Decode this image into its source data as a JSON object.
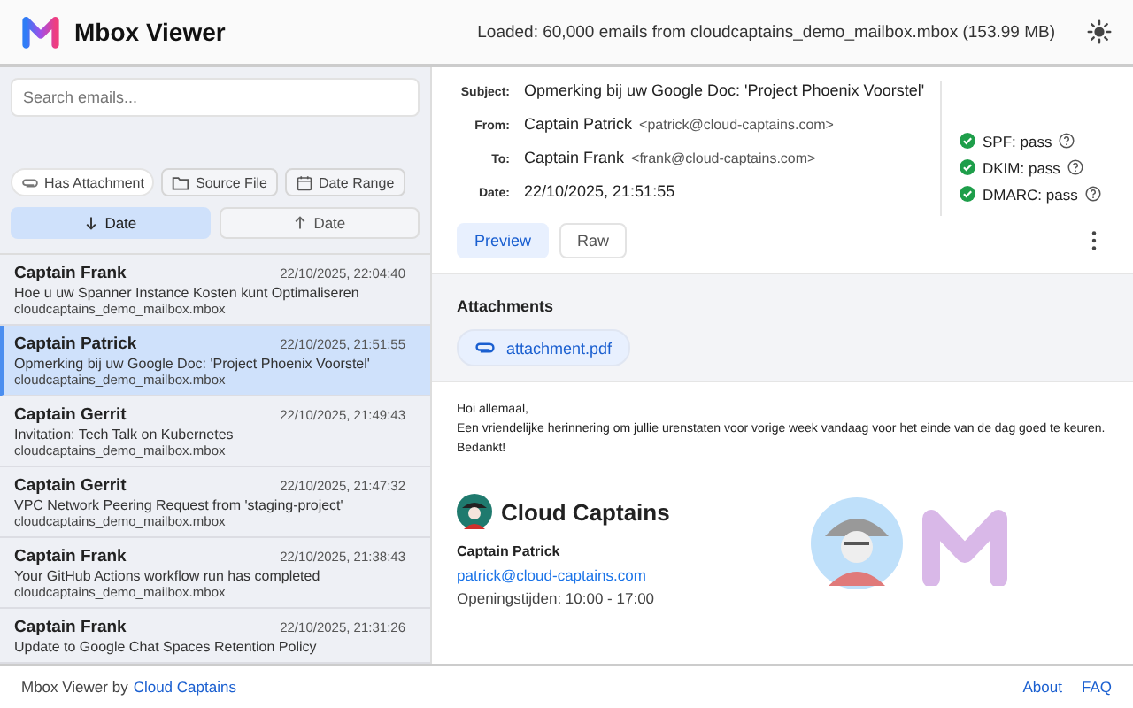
{
  "header": {
    "app_title": "Mbox Viewer",
    "status": "Loaded: 60,000 emails from cloudcaptains_demo_mailbox.mbox (153.99 MB)"
  },
  "search": {
    "placeholder": "Search emails..."
  },
  "filters": [
    {
      "label": "Has Attachment",
      "kind": "toggle"
    },
    {
      "label": "Source File",
      "kind": "folder"
    },
    {
      "label": "Date Range",
      "kind": "calendar"
    }
  ],
  "sort": [
    {
      "label": "Date",
      "kind": "descending",
      "selected": true
    },
    {
      "label": "Date",
      "kind": "ascending",
      "selected": false
    }
  ],
  "emails": [
    {
      "sender": "Captain Frank",
      "date": "22/10/2025, 22:04:40",
      "subject": "Hoe u uw Spanner Instance Kosten kunt Optimaliseren",
      "source": "cloudcaptains_demo_mailbox.mbox",
      "selected": false
    },
    {
      "sender": "Captain Patrick",
      "date": "22/10/2025, 21:51:55",
      "subject": "Opmerking bij uw Google Doc: 'Project Phoenix Voorstel'",
      "source": "cloudcaptains_demo_mailbox.mbox",
      "selected": true
    },
    {
      "sender": "Captain Gerrit",
      "date": "22/10/2025, 21:49:43",
      "subject": "Invitation: Tech Talk on Kubernetes",
      "source": "cloudcaptains_demo_mailbox.mbox",
      "selected": false
    },
    {
      "sender": "Captain Gerrit",
      "date": "22/10/2025, 21:47:32",
      "subject": "VPC Network Peering Request from 'staging-project'",
      "source": "cloudcaptains_demo_mailbox.mbox",
      "selected": false
    },
    {
      "sender": "Captain Frank",
      "date": "22/10/2025, 21:38:43",
      "subject": "Your GitHub Actions workflow run has completed",
      "source": "cloudcaptains_demo_mailbox.mbox",
      "selected": false
    },
    {
      "sender": "Captain Frank",
      "date": "22/10/2025, 21:31:26",
      "subject": "Update to Google Chat Spaces Retention Policy",
      "selected": false
    }
  ],
  "message": {
    "fields": [
      {
        "label": "Subject:",
        "value": "Opmerking bij uw Google Doc: 'Project Phoenix Voorstel'"
      },
      {
        "label": "From:",
        "value": "Captain Patrick",
        "address": "<patrick@cloud-captains.com>"
      },
      {
        "label": "To:",
        "value": "Captain Frank",
        "address": "<frank@cloud-captains.com>"
      },
      {
        "label": "Date:",
        "value": "22/10/2025, 21:51:55"
      }
    ],
    "auth": [
      {
        "label": "SPF: pass"
      },
      {
        "label": "DKIM: pass"
      },
      {
        "label": "DMARC: pass"
      }
    ],
    "view_tabs": [
      {
        "label": "Preview",
        "selected": true
      },
      {
        "label": "Raw",
        "selected": false
      }
    ],
    "attachments_title": "Attachments",
    "attachments": [
      {
        "name": "attachment.pdf"
      }
    ],
    "body": [
      "Hoi allemaal,",
      "Een vriendelijke herinnering om jullie urenstaten voor vorige week vandaag voor het einde van de dag goed te keuren.",
      "Bedankt!"
    ],
    "signature": {
      "company": "Cloud Captains",
      "name": "Captain Patrick",
      "email": "patrick@cloud-captains.com",
      "hours": "Openingstijden: 10:00 - 17:00"
    }
  },
  "footer": {
    "credit": "Mbox Viewer by",
    "credit_link": "Cloud Captains",
    "links": [
      "About",
      "FAQ"
    ]
  }
}
